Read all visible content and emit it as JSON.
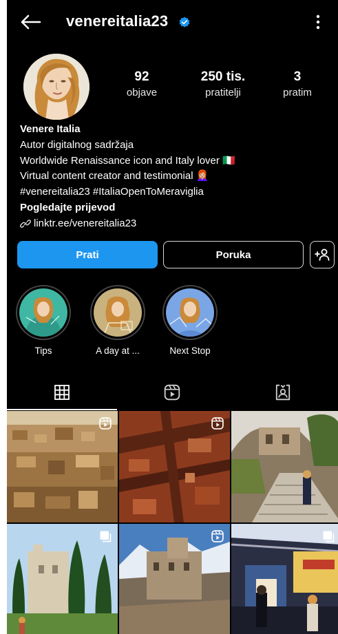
{
  "header": {
    "username": "venereitalia23",
    "back_icon": "arrow-left-icon",
    "verified_icon": "verified-badge-icon",
    "menu_icon": "more-vertical-icon"
  },
  "stats": {
    "posts": {
      "value": "92",
      "label": "objave"
    },
    "followers": {
      "value": "250 tis.",
      "label": "pratitelji"
    },
    "following": {
      "value": "3",
      "label": "pratim"
    }
  },
  "bio": {
    "name": "Venere Italia",
    "category": "Autor digitalnog sadržaja",
    "line1": "Worldwide Renaissance icon and Italy lover 🇮🇹",
    "line2": "Virtual content creator and testimonial 👩🏼‍🦰",
    "hashtags": "#venereitalia23 #ItaliaOpenToMeraviglia",
    "translate": "Pogledajte prijevod",
    "link": "linktr.ee/venereitalia23",
    "link_icon": "link-icon"
  },
  "actions": {
    "follow": "Prati",
    "message": "Poruka",
    "add_user_icon": "add-user-icon"
  },
  "highlights": [
    {
      "label": "Tips"
    },
    {
      "label": "A day at ..."
    },
    {
      "label": "Next Stop"
    }
  ],
  "tabs": [
    {
      "icon": "grid-icon",
      "active": true
    },
    {
      "icon": "reels-icon",
      "active": false
    },
    {
      "icon": "tagged-icon",
      "active": false
    }
  ],
  "colors": {
    "background": "#000000",
    "accent": "#1d96f0",
    "verified": "#1d96f0"
  }
}
